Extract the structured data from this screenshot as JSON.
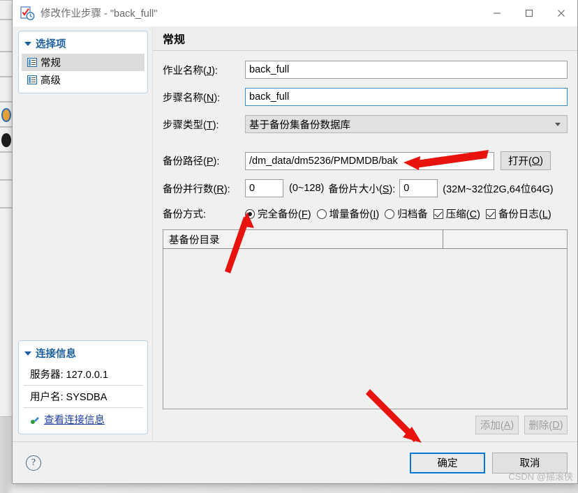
{
  "window": {
    "title": "修改作业步骤 - \"back_full\"",
    "icon": "job-step-edit-icon",
    "minimize_label": "—",
    "maximize_label": "▢",
    "close_label": "✕"
  },
  "sidebar": {
    "options_group": {
      "title": "选择项",
      "items": [
        {
          "label": "常规",
          "icon": "page-list-icon",
          "selected": true
        },
        {
          "label": "高级",
          "icon": "page-list-icon",
          "selected": false
        }
      ]
    },
    "connection_group": {
      "title": "连接信息",
      "server_label": "服务器: 127.0.0.1",
      "user_label": "用户名: SYSDBA",
      "link_label": "查看连接信息",
      "link_icon": "connection-icon"
    }
  },
  "page": {
    "header": "常规",
    "fields": {
      "job_name": {
        "label_pre": "作业名称(",
        "label_key": "J",
        "label_post": "):",
        "value": "back_full"
      },
      "step_name": {
        "label_pre": "步骤名称(",
        "label_key": "N",
        "label_post": "):",
        "value": "back_full"
      },
      "step_type": {
        "label_pre": "步骤类型(",
        "label_key": "T",
        "label_post": "):",
        "value": "基于备份集备份数据库"
      },
      "backup_path": {
        "label_pre": "备份路径(",
        "label_key": "P",
        "label_post": "):",
        "value": "/dm_data/dm5236/PMDMDB/bak"
      },
      "open_button": {
        "label_pre": "打开(",
        "label_key": "O",
        "label_post": ")"
      },
      "parallel": {
        "label_pre": "备份并行数(",
        "label_key": "R",
        "label_post": "):",
        "value": "0",
        "hint": "(0~128)"
      },
      "piece_size": {
        "label_pre": "备份片大小(",
        "label_key": "S",
        "label_post": "):",
        "value": "0",
        "hint": "(32M~32位2G,64位64G)"
      },
      "backup_mode_label": "备份方式:"
    },
    "options": [
      {
        "type": "radio",
        "label_pre": "完全备份(",
        "label_key": "F",
        "label_post": ")",
        "checked": true
      },
      {
        "type": "radio",
        "label_pre": "增量备份(",
        "label_key": "I",
        "label_post": ")",
        "checked": false
      },
      {
        "type": "radio",
        "label_pre": "归档备",
        "label_key": "",
        "label_post": "",
        "checked": false
      },
      {
        "type": "checkbox",
        "label_pre": "压缩(",
        "label_key": "C",
        "label_post": ")",
        "checked": true
      },
      {
        "type": "checkbox",
        "label_pre": "备份日志(",
        "label_key": "L",
        "label_post": ")",
        "checked": true
      }
    ],
    "list": {
      "columns": [
        "基备份目录"
      ],
      "rows": [],
      "add_button": {
        "label_pre": "添加(",
        "label_key": "A",
        "label_post": ")",
        "disabled": true
      },
      "delete_button": {
        "label_pre": "删除(",
        "label_key": "D",
        "label_post": ")",
        "disabled": true
      }
    }
  },
  "footer": {
    "help_label": "?",
    "ok_label": "确定",
    "cancel_label": "取消"
  },
  "watermark": "CSDN @摇滚侠",
  "colors": {
    "accent_blue": "#0078d7",
    "link_blue": "#1d3fa0",
    "group_title_blue": "#1d5f9e",
    "annotation_red": "#e8130d",
    "dialog_bg": "#f0f0f0",
    "titlebar_bg": "#ffffff"
  },
  "annotations": {
    "arrow_backup_path": "红色箭头指向备份路径输入框",
    "arrow_full_backup": "红色箭头指向完全备份单选按钮",
    "arrow_ok_button": "红色箭头指向确定按钮"
  }
}
